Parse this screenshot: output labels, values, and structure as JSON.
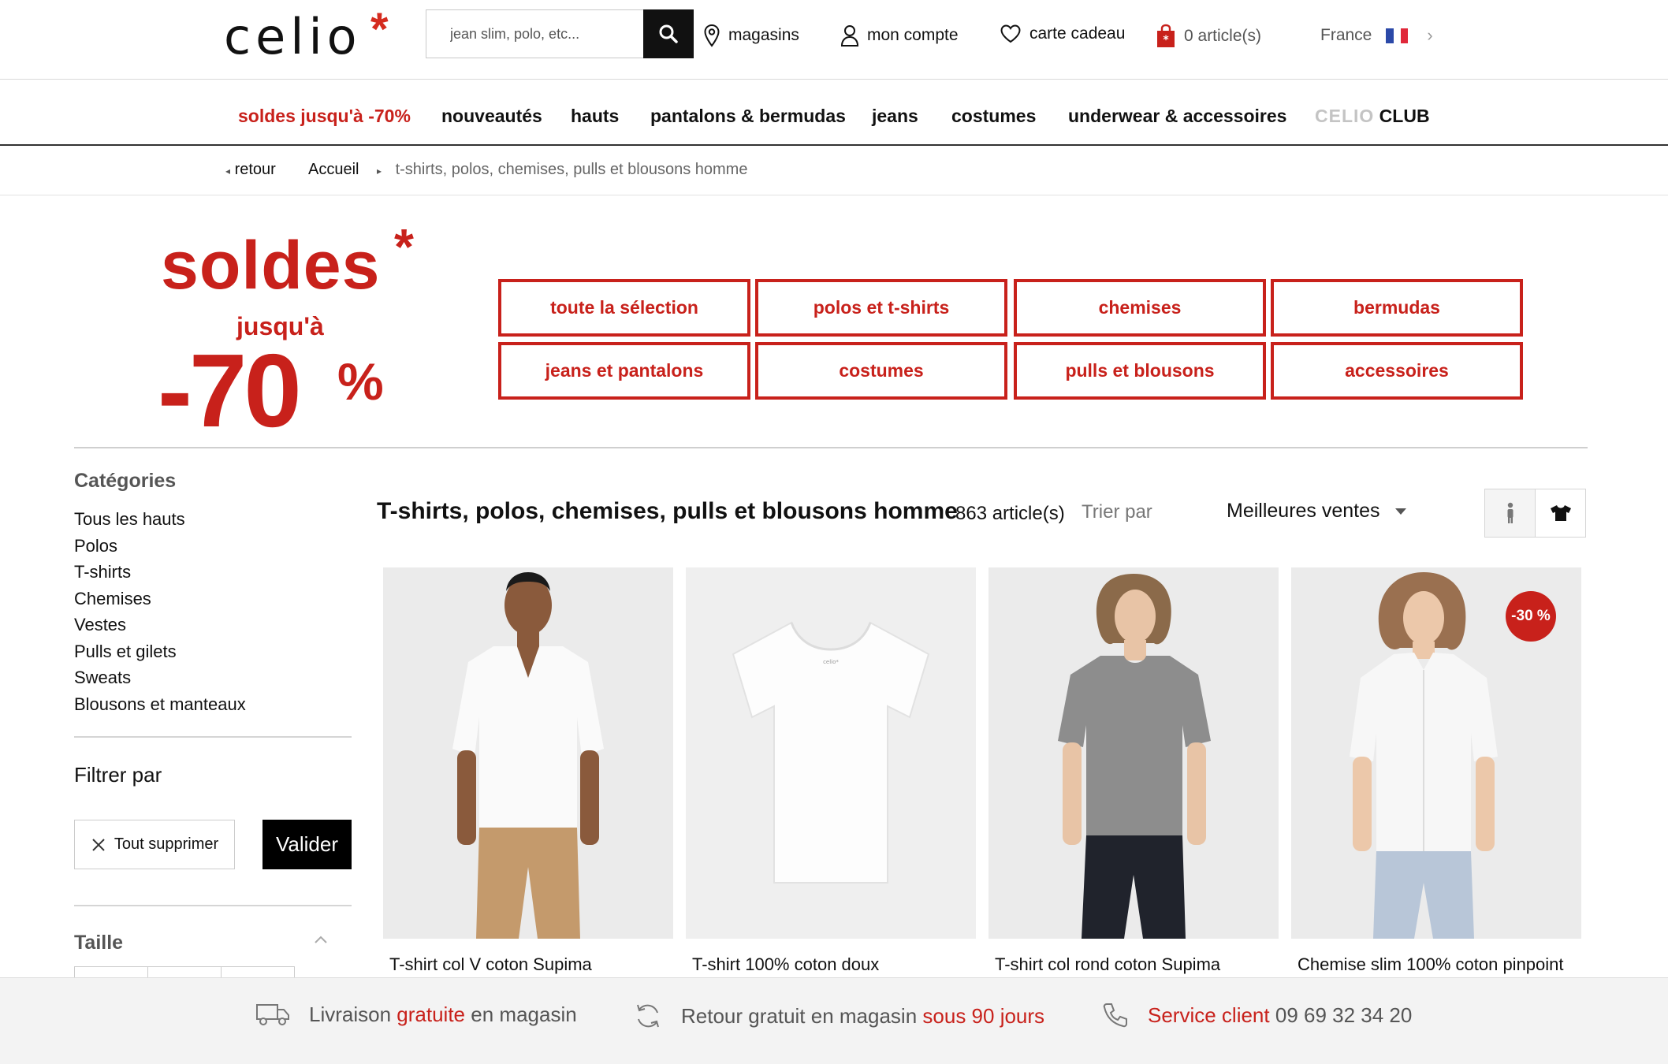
{
  "header": {
    "logo": "celio",
    "logo_star": "*",
    "search_placeholder": "jean slim, polo, etc...",
    "stores": "magasins",
    "account": "mon compte",
    "gift_card": "carte cadeau",
    "cart": "0 article(s)",
    "country": "France"
  },
  "nav": {
    "items": [
      "soldes jusqu'à -70%",
      "nouveautés",
      "hauts",
      "pantalons & bermudas",
      "jeans",
      "costumes",
      "underwear & accessoires"
    ],
    "club_light": "CELIO",
    "club_bold": "CLUB"
  },
  "breadcrumb": {
    "back": "retour",
    "home": "Accueil",
    "current": "t-shirts, polos, chemises, pulls et blousons homme"
  },
  "banner": {
    "soldes": "soldes",
    "star": "*",
    "jusqua": "jusqu'à",
    "pct_num": "-70",
    "pct_sign": "%",
    "categories": [
      "toute la sélection",
      "polos et t-shirts",
      "chemises",
      "bermudas",
      "jeans et pantalons",
      "costumes",
      "pulls et blousons",
      "accessoires"
    ]
  },
  "sidebar": {
    "title": "Catégories",
    "items": [
      "Tous les hauts",
      "Polos",
      "T-shirts",
      "Chemises",
      "Vestes",
      "Pulls et gilets",
      "Sweats",
      "Blousons et manteaux"
    ],
    "filter_title": "Filtrer par",
    "clear_label": "Tout supprimer",
    "validate_label": "Valider",
    "size_title": "Taille"
  },
  "listing": {
    "title": "T-shirts, polos, chemises, pulls et blousons homme",
    "count": "863 article(s)",
    "sort_label": "Trier par",
    "sort_value": "Meilleures ventes"
  },
  "products": [
    {
      "name": "T-shirt col V coton Supima",
      "badge": ""
    },
    {
      "name": "T-shirt 100% coton doux",
      "badge": ""
    },
    {
      "name": "T-shirt col rond coton Supima",
      "badge": ""
    },
    {
      "name": "Chemise slim 100% coton pinpoint",
      "badge": "-30 %"
    }
  ],
  "footer": {
    "delivery_a": "Livraison",
    "delivery_b": "gratuite",
    "delivery_c": "en magasin",
    "return_a": "Retour gratuit en magasin",
    "return_b": "sous 90 jours",
    "service_a": "Service client",
    "service_b": "09 69 32 34 20"
  },
  "colors": {
    "accent_red": "#c8211b",
    "text": "#111111",
    "footer_bg": "#f3f3f3"
  }
}
